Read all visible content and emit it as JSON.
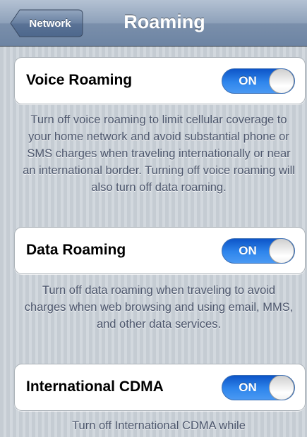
{
  "navbar": {
    "back_label": "Network",
    "title": "Roaming"
  },
  "settings": [
    {
      "label": "Voice Roaming",
      "toggle_label": "ON",
      "toggle_on": true,
      "description": "Turn off voice roaming to limit cellular coverage to your home network and avoid substantial phone or SMS charges when traveling internationally or near an international border. Turning off voice roaming will also turn off data roaming."
    },
    {
      "label": "Data Roaming",
      "toggle_label": "ON",
      "toggle_on": true,
      "description": "Turn off data roaming when traveling to avoid charges when web browsing and using email, MMS, and other data services."
    },
    {
      "label": "International CDMA",
      "toggle_label": "ON",
      "toggle_on": true,
      "description": "Turn off International CDMA while"
    }
  ],
  "colors": {
    "toggle_on": "#2f86ec",
    "navbar": "#8ea1ba",
    "footer_text": "#4c566c"
  }
}
